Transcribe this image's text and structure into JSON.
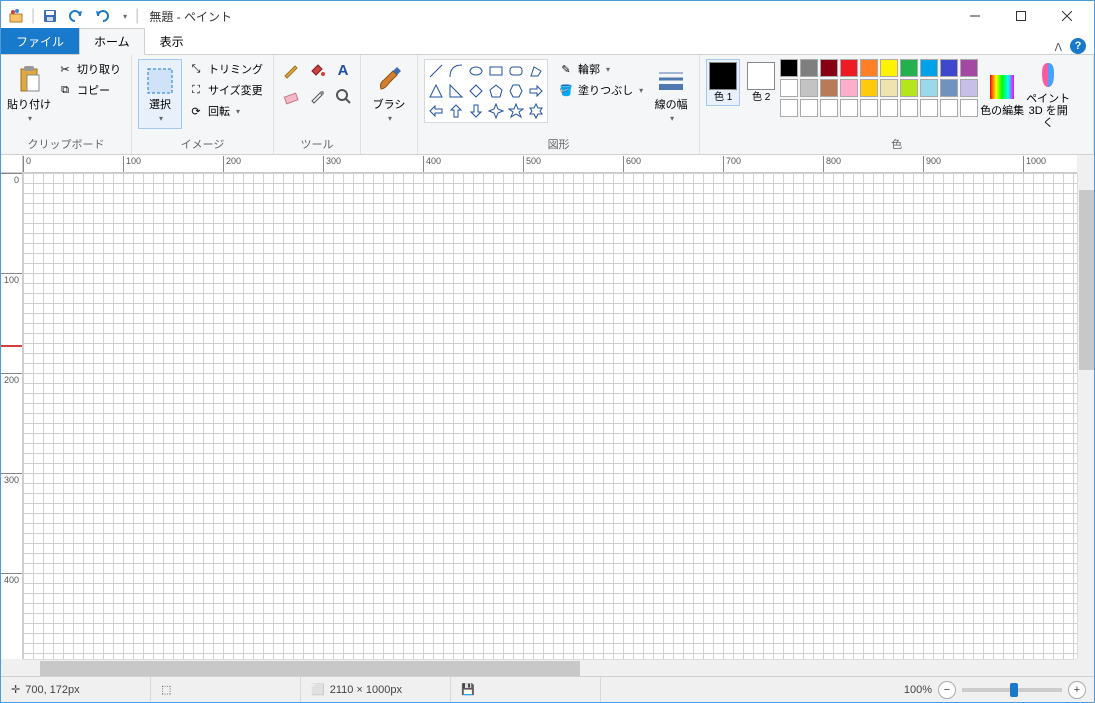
{
  "window": {
    "title": "無題 - ペイント"
  },
  "tabs": {
    "file": "ファイル",
    "home": "ホーム",
    "view": "表示"
  },
  "ribbon": {
    "clipboard": {
      "paste": "貼り付け",
      "cut": "切り取り",
      "copy": "コピー",
      "label": "クリップボード"
    },
    "image": {
      "select": "選択",
      "crop": "トリミング",
      "resize": "サイズ変更",
      "rotate": "回転",
      "label": "イメージ"
    },
    "tools": {
      "label": "ツール"
    },
    "brushes": {
      "brush": "ブラシ"
    },
    "shapes": {
      "outline": "輪郭",
      "fill": "塗りつぶし",
      "width": "線の幅",
      "label": "図形"
    },
    "colors": {
      "c1": "色 1",
      "c2": "色 2",
      "edit": "色の編集",
      "label": "色"
    },
    "paint3d": {
      "open": "ペイント 3D を開く"
    }
  },
  "palette_row1": [
    "#000000",
    "#7f7f7f",
    "#880015",
    "#ed1c24",
    "#ff7f27",
    "#fff200",
    "#22b14c",
    "#00a2e8",
    "#3f48cc",
    "#a349a4"
  ],
  "palette_row2": [
    "#ffffff",
    "#c3c3c3",
    "#b97a57",
    "#ffaec9",
    "#ffc90e",
    "#efe4b0",
    "#b5e61d",
    "#99d9ea",
    "#7092be",
    "#c8bfe7"
  ],
  "status": {
    "cursor": "700, 172px",
    "canvas_size": "2110 × 1000px",
    "zoom": "100%"
  },
  "ruler_h": [
    "0",
    "100",
    "200",
    "300",
    "400",
    "500",
    "600",
    "700",
    "800",
    "900",
    "1000"
  ],
  "ruler_v": [
    "0",
    "100",
    "200",
    "300",
    "400"
  ],
  "color1": "#000000",
  "color2": "#ffffff"
}
